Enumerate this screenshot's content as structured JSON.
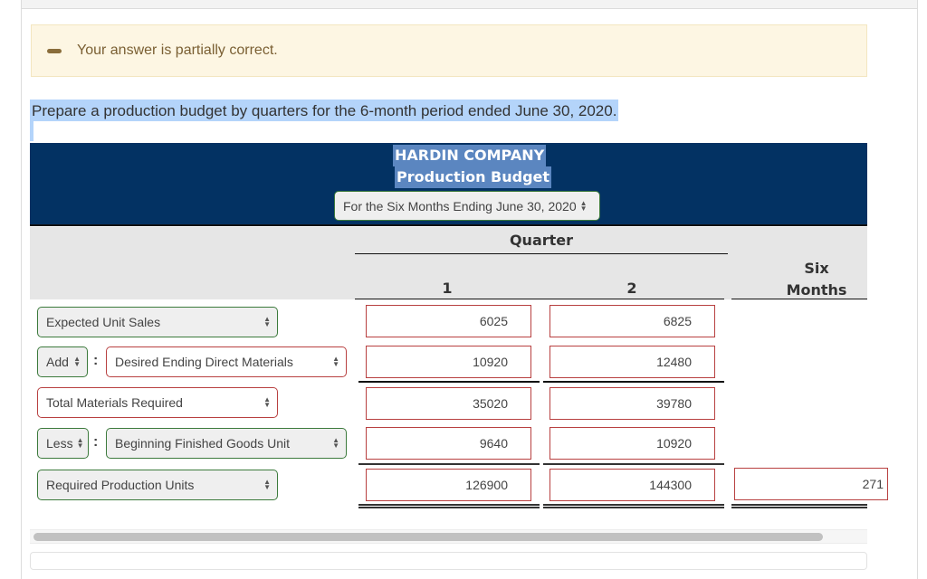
{
  "feedback": {
    "icon": "minus-icon",
    "message": "Your answer is partially correct."
  },
  "instruction": "Prepare a production budget by quarters for the 6-month period ended June 30, 2020.",
  "header": {
    "company": "HARDIN COMPANY",
    "title": "Production Budget",
    "period_select_value": "For the Six Months Ending June 30, 2020"
  },
  "columns": {
    "group_label": "Quarter",
    "q1": "1",
    "q2": "2",
    "six_months_line1": "Six",
    "six_months_line2": "Months"
  },
  "rows": [
    {
      "label": "Expected Unit Sales",
      "q1": "6025",
      "q2": "6825",
      "six": ""
    },
    {
      "operator": "Add",
      "label": "Desired Ending Direct Materials",
      "q1": "10920",
      "q2": "12480",
      "six": ""
    },
    {
      "label": "Total Materials Required",
      "q1": "35020",
      "q2": "39780",
      "six": ""
    },
    {
      "operator": "Less",
      "label": "Beginning Finished Goods Unit",
      "q1": "9640",
      "q2": "10920",
      "six": ""
    },
    {
      "label": "Required Production Units",
      "q1": "126900",
      "q2": "144300",
      "six": "271"
    }
  ],
  "colors": {
    "header_bg": "#033263",
    "feedback_bg": "#fdf6e3",
    "correct_border": "#3c7a3c",
    "incorrect_border": "#b84040",
    "selection_bg": "#b4d4fa"
  }
}
